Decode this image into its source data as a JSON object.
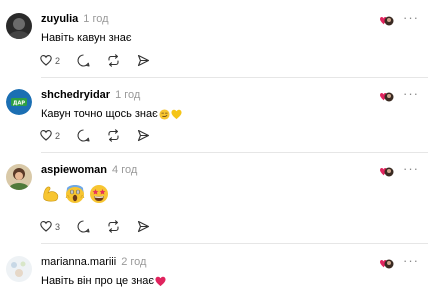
{
  "posts": [
    {
      "username": "zuyulia",
      "time": "1 год",
      "text": "Навіть кавун знає",
      "likes": "2",
      "more": "···"
    },
    {
      "username": "shchedryidar",
      "time": "1 год",
      "text": "Кавун точно щось знає",
      "emojis": [
        "smirking-face",
        "yellow-heart"
      ],
      "likes": "2",
      "more": "···",
      "avatar_text": "ДАР"
    },
    {
      "username": "aspiewoman",
      "time": "4 год",
      "emojis": [
        "flexed-biceps",
        "face-screaming-in-fear",
        "star-struck"
      ],
      "likes": "3",
      "more": "···"
    },
    {
      "username": "marianna.mariii",
      "time": "2 год",
      "text": "Навіть він про це знає",
      "emojis": [
        "red-heart"
      ],
      "more": "···"
    }
  ],
  "colors": {
    "username": "#000000",
    "time": "#999999",
    "divider": "#e6e6e6",
    "icon": "#333333",
    "liked_heart": "#e0245e"
  },
  "icons": [
    "heart-icon",
    "comment-icon",
    "repost-icon",
    "share-icon",
    "more-icon"
  ]
}
